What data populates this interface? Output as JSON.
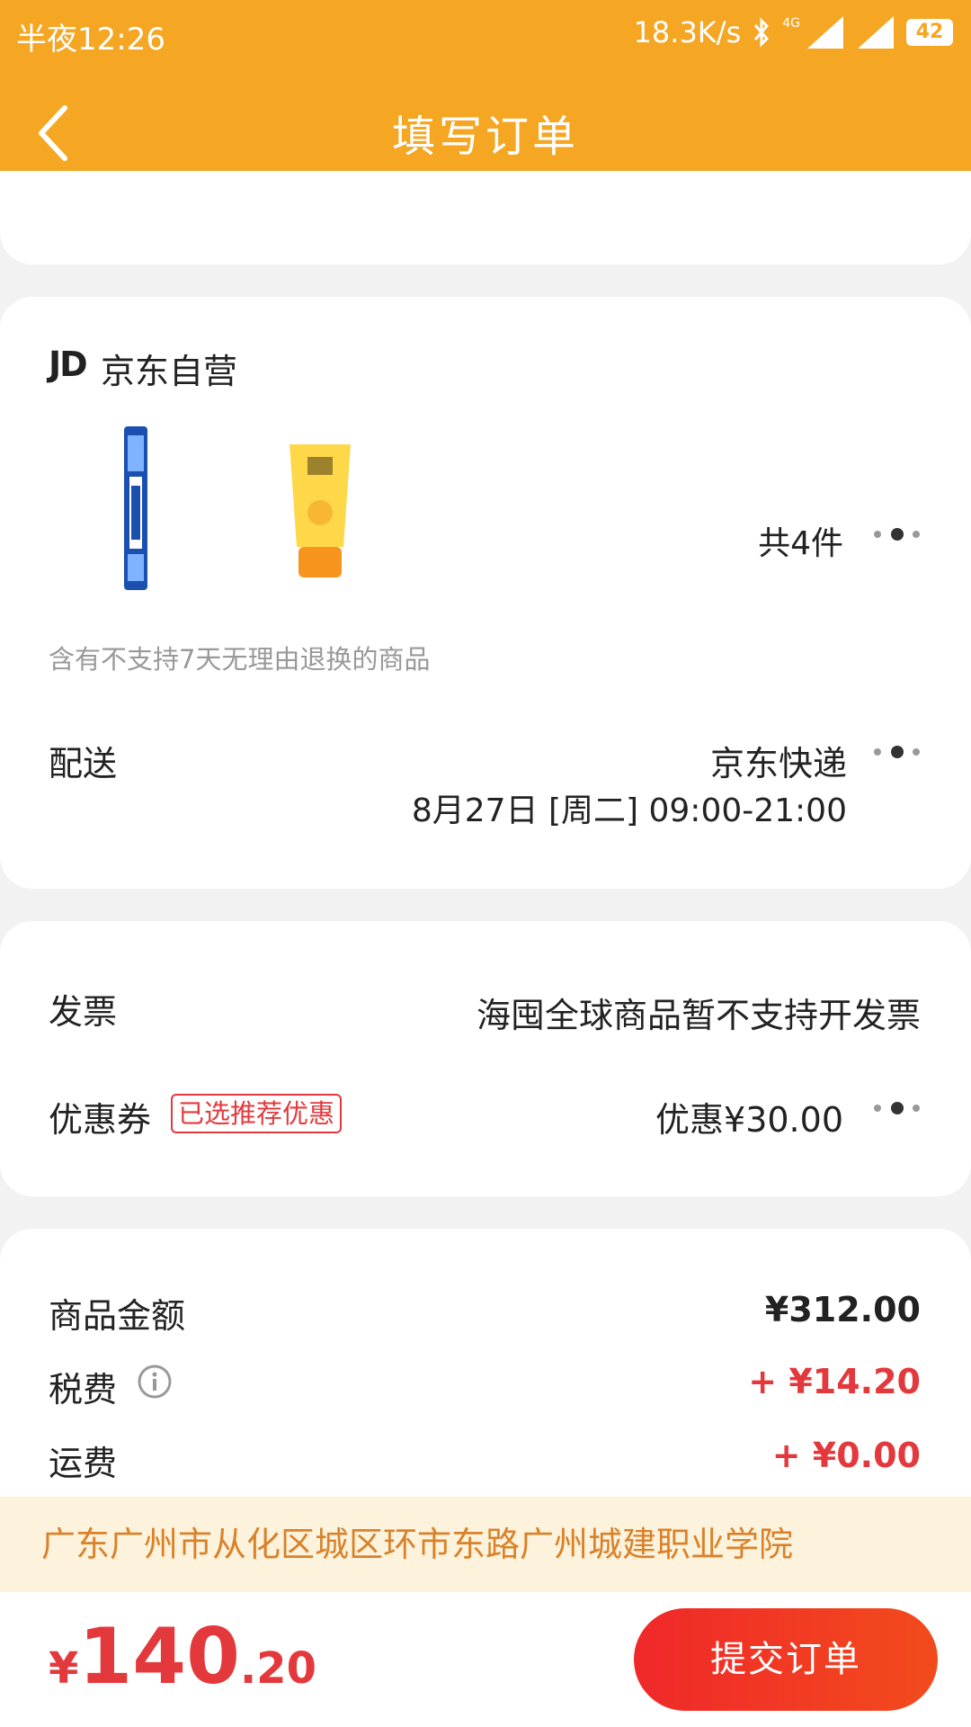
{
  "status_bar": {
    "time": "半夜12:26",
    "net_speed": "18.3K/s",
    "net_type": "4G",
    "battery": "42"
  },
  "header": {
    "title": "填写订单"
  },
  "store": {
    "logo": "JD",
    "name": "京东自营",
    "total_count": "共4件",
    "return_note": "含有不支持7天无理由退换的商品",
    "delivery_label": "配送",
    "delivery_method": "京东快递",
    "delivery_time": "8月27日 [周二] 09:00-21:00"
  },
  "invoice": {
    "label": "发票",
    "value": "海囤全球商品暂不支持开发票"
  },
  "coupon": {
    "label": "优惠券",
    "badge": "已选推荐优惠",
    "value": "优惠¥30.00"
  },
  "amounts": {
    "goods_label": "商品金额",
    "goods_value": "¥312.00",
    "tax_label": "税费",
    "tax_value": "+ ¥14.20",
    "shipping_label": "运费",
    "shipping_value": "+ ¥0.00"
  },
  "address": "广东广州市从化区城区环市东路广州城建职业学院",
  "footer": {
    "currency": "¥",
    "total_int": "140",
    "total_dec": ".20",
    "submit_label": "提交订单"
  },
  "colors": {
    "header": "#f5a623",
    "accent_red": "#e4393c",
    "address_bg": "#fdf3dc",
    "address_text": "#d9822b"
  }
}
